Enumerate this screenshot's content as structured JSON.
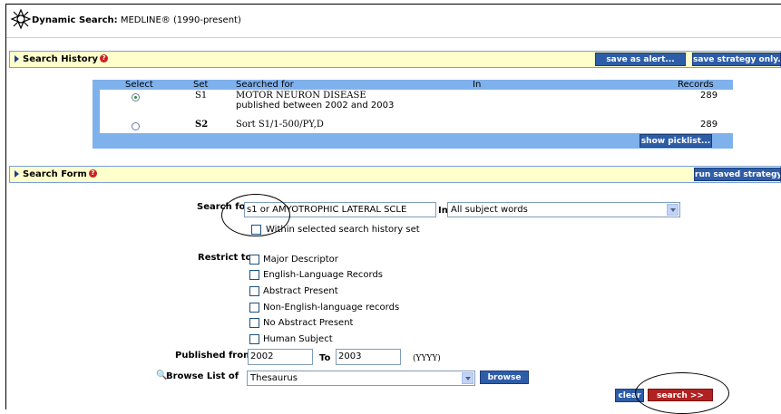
{
  "header": {
    "title_bold": "Dynamic Search:",
    "title_rest": " MEDLINE® (1990-present)"
  },
  "history_section": {
    "title": "Search History",
    "save_alert_label": "save as alert...",
    "save_strategy_label": "save strategy only..."
  },
  "history_table": {
    "columns": [
      "Select",
      "Set",
      "Searched for",
      "In",
      "Records"
    ],
    "rows": [
      {
        "set": "S1",
        "searched_for": "MOTOR NEURON DISEASE",
        "detail": "published between 2002 and 2003",
        "records": "289",
        "selected": true
      },
      {
        "set": "S2",
        "searched_for": "Sort S1/1-500/PY,D",
        "detail": "",
        "records": "289",
        "selected": false
      }
    ],
    "picklist_label": "show picklist..."
  },
  "form_section": {
    "title": "Search Form",
    "run_saved_label": "run saved strategy..."
  },
  "search_form": {
    "search_for_label": "Search for",
    "search_value": "s1 or AMYOTROPHIC LATERAL SCLE",
    "in_label": "In",
    "in_value": "All subject words",
    "within_label": "Within selected search history set",
    "restrict_label": "Restrict to",
    "restrict_options": [
      "Major Descriptor",
      "English-Language Records",
      "Abstract Present",
      "Non-English-language records",
      "No Abstract Present",
      "Human Subject"
    ],
    "published_from_label": "Published from",
    "published_from_value": "2002",
    "to_label": "To",
    "to_value": "2003",
    "date_format": "(YYYY)",
    "browse_list_label": "Browse List of",
    "browse_list_value": "Thesaurus",
    "browse_button_label": "browse",
    "clear_label": "clear",
    "search_button_label": "search >>"
  },
  "colors": {
    "section_bg": "#ffffcc",
    "table_blue": "#7fb1ec",
    "button_blue": "#2e5da8",
    "button_red": "#b22222"
  }
}
